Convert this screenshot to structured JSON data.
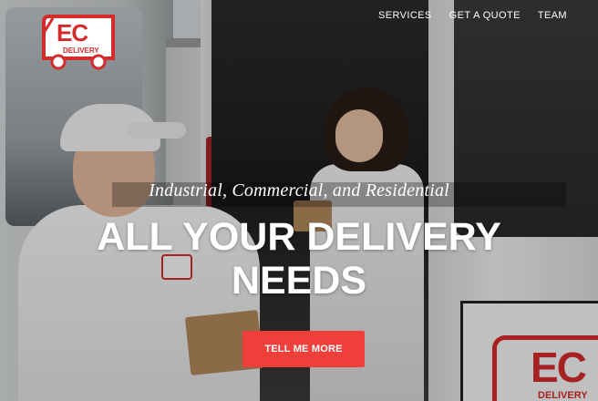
{
  "brand": {
    "logo_text": "EC",
    "logo_subtext": "DELIVERY",
    "accent_color": "#ef3f3a"
  },
  "nav": {
    "items": [
      {
        "label": "SERVICES"
      },
      {
        "label": "GET A QUOTE"
      },
      {
        "label": "TEAM"
      }
    ]
  },
  "hero": {
    "subtitle": "Industrial, Commercial, and Residential",
    "headline_line1": "ALL YOUR DELIVERY",
    "headline_line2": "NEEDS",
    "cta_label": "TELL ME MORE"
  }
}
